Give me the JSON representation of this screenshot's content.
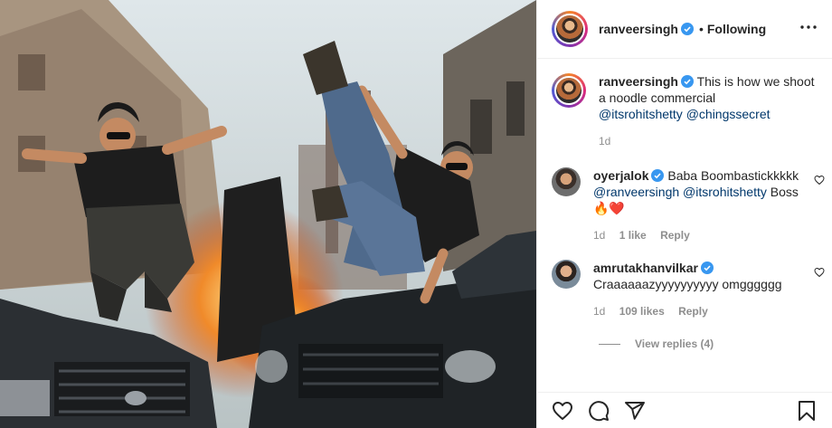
{
  "post": {
    "photo_alt": "",
    "author": {
      "username": "ranveersingh",
      "verified": true,
      "follow_status": "Following",
      "follow_separator": "•"
    },
    "caption": {
      "username": "ranveersingh",
      "text": "This is how we shoot a noodle commercial",
      "mentions": [
        "@itsrohitshetty",
        "@chingssecret"
      ],
      "time": "1d"
    },
    "comments": [
      {
        "username": "oyerjalok",
        "verified": true,
        "text_1": "Baba Boombastickkkkk",
        "mention_1": "@ranveersingh",
        "mention_2": "@itsrohitshetty",
        "text_2": "Boss 🔥❤️",
        "time": "1d",
        "likes": "1 like",
        "reply_label": "Reply"
      },
      {
        "username": "amrutakhanvilkar",
        "verified": true,
        "text": "Craaaaaazyyyyyyyyyy omgggggg",
        "time": "1d",
        "likes": "109 likes",
        "reply_label": "Reply",
        "view_replies": "View replies (4)"
      }
    ],
    "actions": [
      "heart-icon",
      "comment-icon",
      "share-icon",
      "bookmark-icon"
    ],
    "colors": {
      "accent_blue": "#3897f0",
      "mention": "#00376b",
      "muted": "#8e8e8e",
      "text": "#262626"
    }
  }
}
